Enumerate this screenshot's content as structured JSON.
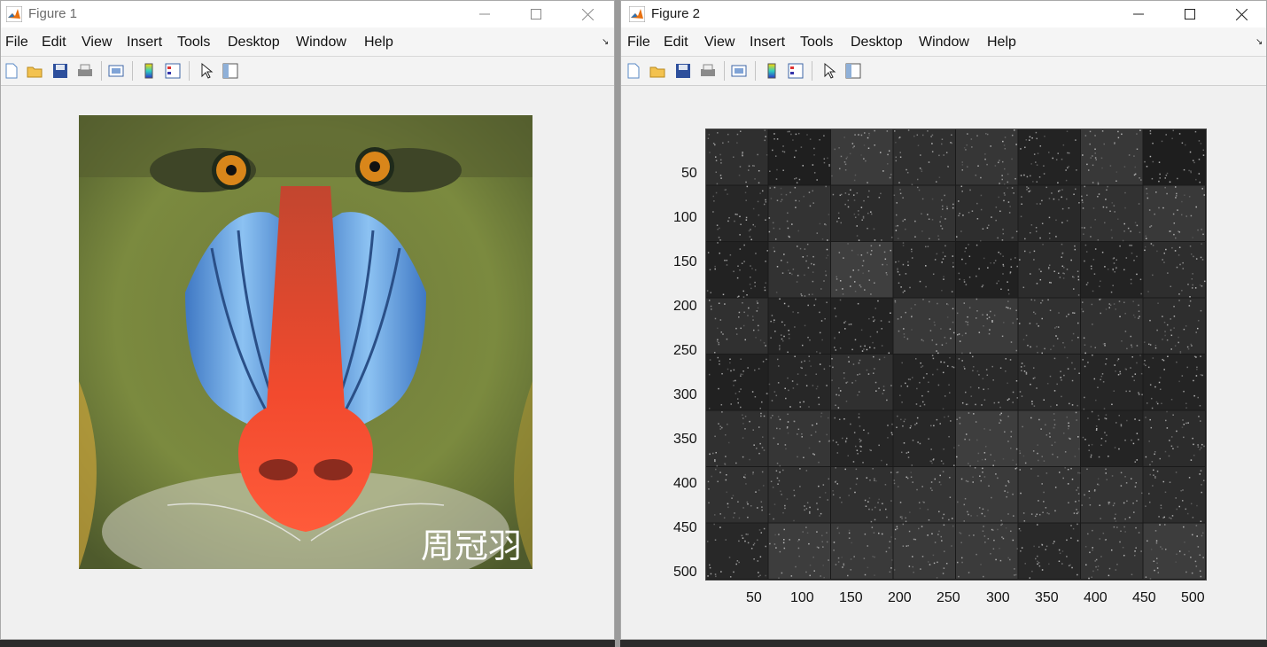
{
  "fig1": {
    "title": "Figure 1",
    "menu": [
      "File",
      "Edit",
      "View",
      "Insert",
      "Tools",
      "Desktop",
      "Window",
      "Help"
    ],
    "watermark": "周冠羽"
  },
  "fig2": {
    "title": "Figure 2",
    "menu": [
      "File",
      "Edit",
      "View",
      "Insert",
      "Tools",
      "Desktop",
      "Window",
      "Help"
    ],
    "y_ticks": [
      "50",
      "100",
      "150",
      "200",
      "250",
      "300",
      "350",
      "400",
      "450",
      "500"
    ],
    "x_ticks": [
      "50",
      "100",
      "150",
      "200",
      "250",
      "300",
      "350",
      "400",
      "450",
      "500"
    ]
  },
  "icons": [
    "new-figure-icon",
    "open-icon",
    "save-icon",
    "print-icon",
    "print-preview-icon",
    "colorbar-icon",
    "legend-icon",
    "pointer-icon",
    "property-inspector-icon"
  ]
}
